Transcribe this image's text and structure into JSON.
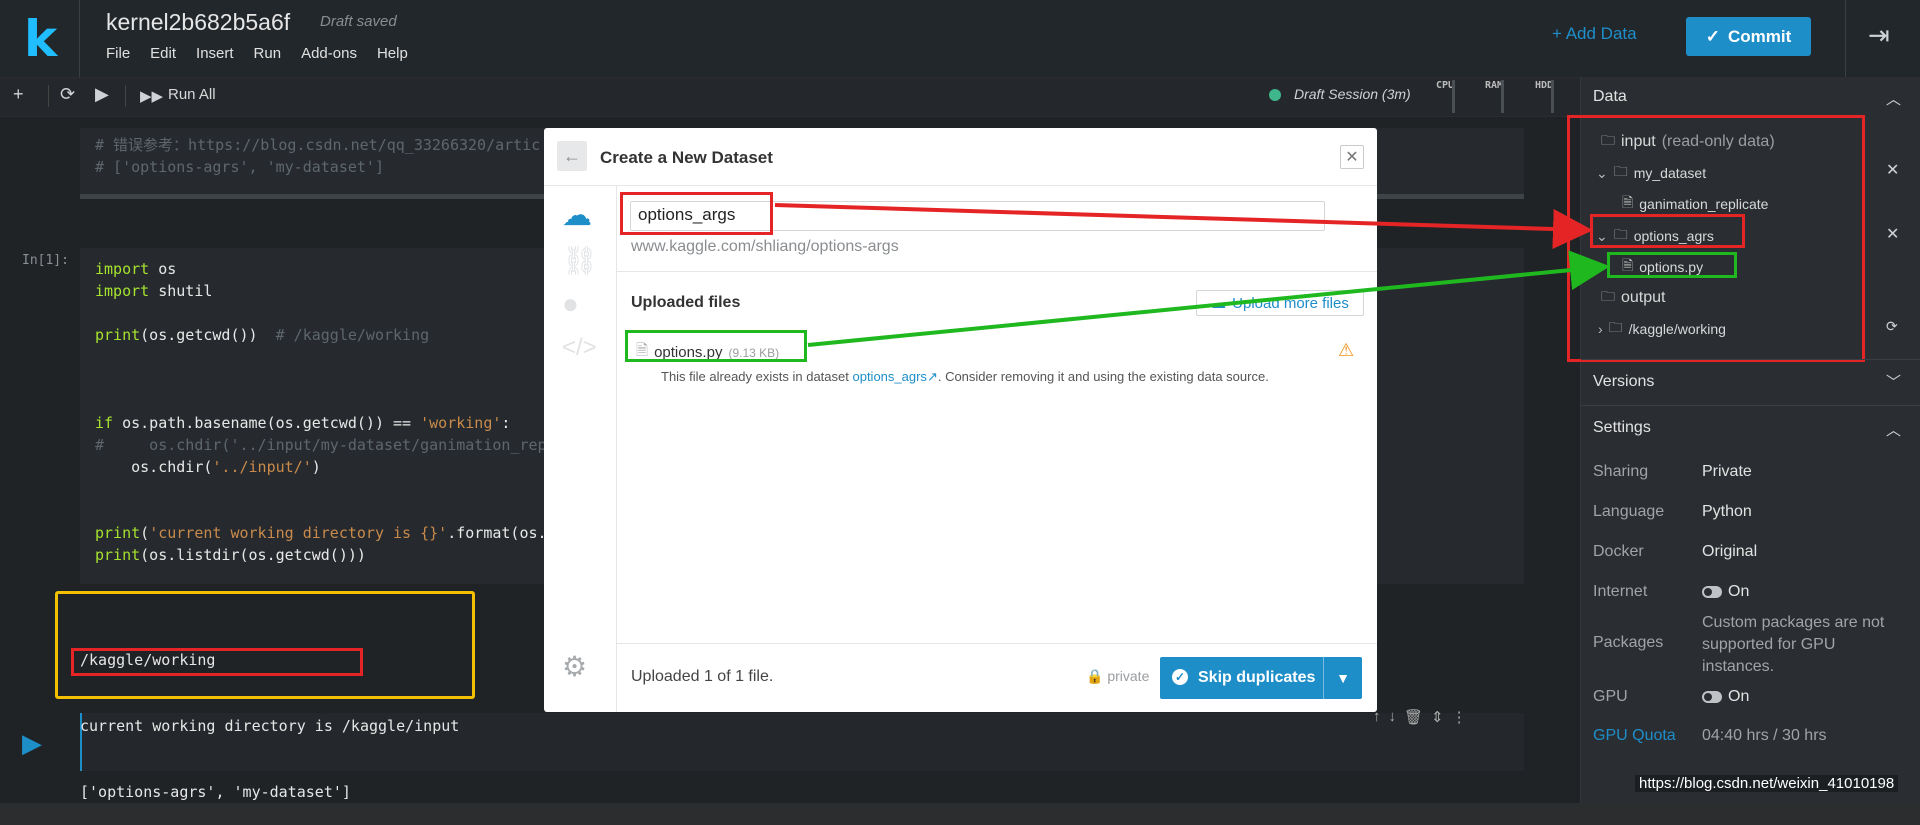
{
  "header": {
    "logo": "k",
    "title": "kernel2b682b5a6f",
    "saved": "Draft saved",
    "menu": [
      "File",
      "Edit",
      "Insert",
      "Run",
      "Add-ons",
      "Help"
    ],
    "add_data": "+ Add Data",
    "commit": "Commit"
  },
  "toolbar": {
    "run_all": "Run All",
    "session": "Draft Session (3m)",
    "meters": [
      "CPU",
      "RAM",
      "HDD"
    ]
  },
  "notebook": {
    "cell0_lines": [
      "# 错误参考：https://blog.csdn.net/qq_33266320/artic",
      "# ['options-agrs', 'my-dataset']"
    ],
    "in_label": "In[1]:",
    "cell1_lines": [
      "import os",
      "import shutil",
      "",
      "print(os.getcwd())  # /kaggle/working",
      "",
      "",
      "",
      "if os.path.basename(os.getcwd()) == 'working':",
      "#     os.chdir('../input/my-dataset/ganimation_repl",
      "    os.chdir('../input/')",
      "",
      "",
      "print('current working directory is {}'.format(os.g",
      "print(os.listdir(os.getcwd()))"
    ],
    "output_lines": [
      "/kaggle/working",
      "current working directory is /kaggle/input",
      "['options-agrs', 'my-dataset']"
    ]
  },
  "right_panel": {
    "data_title": "Data",
    "input_label": "input",
    "input_note": "(read-only data)",
    "dataset1": "my_dataset",
    "dataset1_file": "ganimation_replicate",
    "dataset2": "options_agrs",
    "dataset2_file": "options.py",
    "output_label": "output",
    "working": "/kaggle/working",
    "versions_title": "Versions",
    "settings_title": "Settings",
    "settings": {
      "sharing_label": "Sharing",
      "sharing": "Private",
      "language_label": "Language",
      "language": "Python",
      "docker_label": "Docker",
      "docker": "Original",
      "internet_label": "Internet",
      "internet": "On",
      "packages_label": "Packages",
      "packages": "Custom packages are not supported for GPU instances.",
      "gpu_label": "GPU",
      "gpu": "On",
      "quota_label": "GPU Quota",
      "quota": "04:40 hrs / 30 hrs"
    },
    "watermark": "https://blog.csdn.net/weixin_41010198"
  },
  "modal": {
    "title": "Create a New Dataset",
    "name_value": "options_args",
    "url": "www.kaggle.com/shliang/options-args",
    "uploaded_heading": "Uploaded files",
    "upload_more": "Upload more files",
    "file_name": "options.py",
    "file_size": "(9.13 KB)",
    "warning_pre": "This file already exists in dataset ",
    "warning_link": "options_agrs",
    "warning_post": ". Consider removing it and using the existing data source.",
    "status": "Uploaded 1 of 1 file.",
    "privacy": "private",
    "skip_button": "Skip duplicates"
  },
  "colors": {
    "accent": "#1e8ec9",
    "annotation_red": "#e52525",
    "annotation_green": "#1fb81f",
    "annotation_yellow": "#f2c000"
  }
}
